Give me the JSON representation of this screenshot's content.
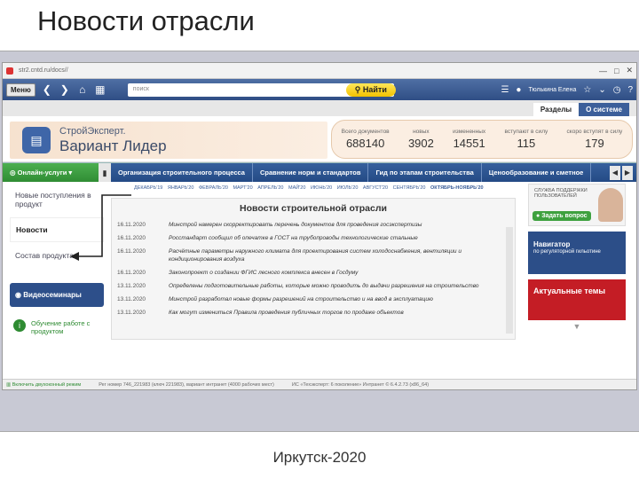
{
  "slide": {
    "title": "Новости отрасли",
    "footer": "Иркутск-2020"
  },
  "browser": {
    "url": "str2.cntd.ru/docs//",
    "controls": [
      "—",
      "□",
      "✕"
    ]
  },
  "toolbar": {
    "menu_label": "Меню",
    "search_placeholder": "поиск",
    "find_label": "Найти",
    "user_name": "Тюлькина Елена"
  },
  "tabs": [
    "Разделы",
    "О системе"
  ],
  "logo": {
    "line1": "СтройЭксперт.",
    "line2": "Вариант Лидер"
  },
  "stats": [
    {
      "label": "Всего документов",
      "value": "688140"
    },
    {
      "label": "новых",
      "value": "3902"
    },
    {
      "label": "измененных",
      "value": "14551"
    },
    {
      "label": "вступают в силу",
      "value": "115"
    },
    {
      "label": "скоро вступят в силу",
      "value": "179"
    }
  ],
  "menubar": {
    "green_label": "Онлайн-услуги",
    "items": [
      "Организация строительного процесса",
      "Сравнение норм и стандартов",
      "Гид по этапам строительства",
      "Ценообразование и сметное"
    ]
  },
  "sidebar": {
    "new_items": "Новые поступления в продукт",
    "news": "Новости",
    "composition": "Состав продукта",
    "video": "Видеосеминары",
    "learn": "Обучение работе с продуктом"
  },
  "months": {
    "items": [
      "ДЕКАБРЬ'19",
      "ЯНВАРЬ'20",
      "ФЕВРАЛЬ'20",
      "МАРТ'20",
      "АПРЕЛЬ'20",
      "МАЙ'20",
      "ИЮНЬ'20",
      "ИЮЛЬ'20",
      "АВГУСТ'20",
      "СЕНТЯБРЬ'20"
    ],
    "selected": "ОКТЯБРЬ-НОЯБРЬ'20"
  },
  "news": {
    "header": "Новости строительной отрасли",
    "rows": [
      {
        "date": "16.11.2020",
        "text": "Минстрой намерен скорректировать перечень документов для проведения госэкспертизы"
      },
      {
        "date": "16.11.2020",
        "text": "Росстандарт сообщил об опечатке в ГОСТ на трубопроводы технологические стальные"
      },
      {
        "date": "16.11.2020",
        "text": "Расчётные параметры наружного климата для проектирования систем холодоснабжения, вентиляции и кондиционирования воздуха"
      },
      {
        "date": "16.11.2020",
        "text": "Законопроект о создании ФГИС лесного комплекса внесен в Госдуму"
      },
      {
        "date": "13.11.2020",
        "text": "Определены подготовительные работы, которые можно проводить до выдачи разрешения на строительство"
      },
      {
        "date": "13.11.2020",
        "text": "Минстрой разработал новые формы разрешений на строительство и на ввод в эксплуатацию"
      },
      {
        "date": "13.11.2020",
        "text": "Как могут измениться Правила проведения публичных торгов по продаже объектов"
      }
    ]
  },
  "right": {
    "help_text": "СЛУЖБА ПОДДЕРЖКИ ПОЛЬЗОВАТЕЛЕЙ",
    "help_button": "Задать вопрос",
    "nav_title": "Навигатор",
    "nav_sub": "по регуляторной гильотине",
    "topics": "Актуальные темы"
  },
  "status": {
    "left": "Включить двухоконный режим",
    "mid": "Рег номер 746_221983 (ключ 221983), вариант интранет (4000 рабочих мест)",
    "right": "ИС «Техэксперт: 6 поколение» Интранет © 6.4.2.73 (x86_64)"
  }
}
